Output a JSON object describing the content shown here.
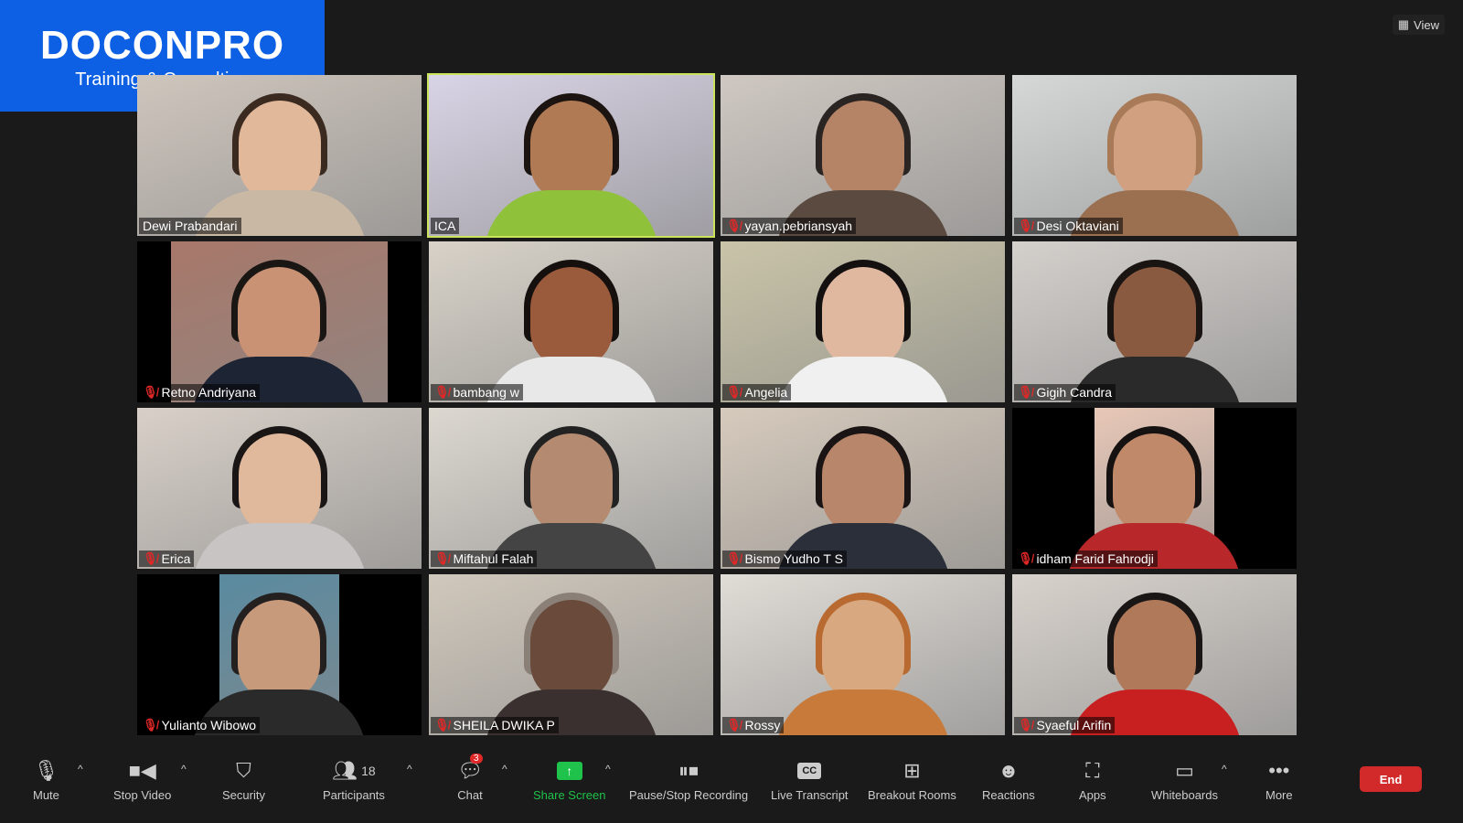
{
  "logo": {
    "title": "DOCONPRO",
    "subtitle": "Training & Consulting"
  },
  "view_button": {
    "label": "View",
    "icon": "grid-icon"
  },
  "participants": [
    {
      "name": "Dewi Prabandari",
      "muted": false,
      "bg": "#cfc6bd",
      "skin": "#e2b89a",
      "hair": "#3a2a20",
      "shirt": "#c9b9a4"
    },
    {
      "name": "ICA",
      "muted": false,
      "active": true,
      "bg": "#d9d4e6",
      "skin": "#b07a55",
      "hair": "#1c1410",
      "shirt": "#8fc23a"
    },
    {
      "name": "yayan.pebriansyah",
      "muted": true,
      "bg": "#cfc8c2",
      "skin": "#b58466",
      "hair": "#2a2422",
      "shirt": "#5a4a40"
    },
    {
      "name": "Desi Oktaviani",
      "muted": true,
      "bg": "#d6d8d8",
      "skin": "#d0a080",
      "hair": "#a87a58",
      "shirt": "#9a7050"
    },
    {
      "name": "Retno Andriyana",
      "muted": true,
      "bg": "#a8786a",
      "skin": "#c99274",
      "hair": "#1a1614",
      "shirt": "#1d2434",
      "pillar": [
        12,
        88
      ]
    },
    {
      "name": "bambang w",
      "muted": true,
      "bg": "#d8d2c8",
      "skin": "#9a5a3c",
      "hair": "#15100e",
      "shirt": "#e8e8e8"
    },
    {
      "name": "Angelia",
      "muted": true,
      "bg": "#c9c4a8",
      "skin": "#e0b8a0",
      "hair": "#141010",
      "shirt": "#f0f0f0"
    },
    {
      "name": "Gigih Candra",
      "muted": true,
      "bg": "#d4d0cc",
      "skin": "#8a5a40",
      "hair": "#1a1412",
      "shirt": "#2a2a2a"
    },
    {
      "name": "Erica",
      "muted": true,
      "bg": "#d8d0c8",
      "skin": "#e0b89c",
      "hair": "#1a1616",
      "shirt": "#c8c4c4"
    },
    {
      "name": "Miftahul Falah",
      "muted": true,
      "bg": "#dcd8d0",
      "skin": "#b48a70",
      "hair": "#222",
      "shirt": "#444"
    },
    {
      "name": "Bismo Yudho T S",
      "muted": true,
      "bg": "#d6cabc",
      "skin": "#b8866a",
      "hair": "#1a1414",
      "shirt": "#2a2f3a"
    },
    {
      "name": "idham Farid Fahrodji",
      "muted": true,
      "bg": "#e8c8b8",
      "skin": "#c08a6a",
      "hair": "#161212",
      "shirt": "#b8282a",
      "pillar": [
        29,
        71
      ]
    },
    {
      "name": "Yulianto Wibowo",
      "muted": true,
      "bg": "#5a8aa0",
      "skin": "#c89a7c",
      "hair": "#242020",
      "shirt": "#2a2a2a",
      "pillar": [
        29,
        71
      ]
    },
    {
      "name": "SHEILA DWIKA P",
      "muted": true,
      "bg": "#d0c8bc",
      "skin": "#6a4a3a",
      "hair": "#8a8078",
      "shirt": "#3a3030"
    },
    {
      "name": "Rossy",
      "muted": true,
      "bg": "#e0dcd6",
      "skin": "#d8a880",
      "hair": "#b86a30",
      "shirt": "#c87a3a"
    },
    {
      "name": "Syaeful Arifin",
      "muted": true,
      "bg": "#d8d2cc",
      "skin": "#b07a5a",
      "hair": "#1a1616",
      "shirt": "#c82020"
    }
  ],
  "toolbar": {
    "mute": {
      "label": "Mute",
      "icon": "microphone-icon"
    },
    "video": {
      "label": "Stop Video",
      "icon": "video-camera-icon"
    },
    "security": {
      "label": "Security",
      "icon": "shield-icon"
    },
    "participants": {
      "label": "Participants",
      "count": "18",
      "icon": "participants-icon"
    },
    "chat": {
      "label": "Chat",
      "badge": "3",
      "icon": "chat-icon"
    },
    "share": {
      "label": "Share Screen",
      "icon": "share-arrow-icon",
      "color": "#1fc24a"
    },
    "recording": {
      "label": "Pause/Stop Recording",
      "icon": "pause-stop-icon"
    },
    "transcript": {
      "label": "Live Transcript",
      "icon": "cc-icon",
      "glyph": "CC"
    },
    "breakout": {
      "label": "Breakout Rooms",
      "icon": "breakout-grid-icon"
    },
    "reactions": {
      "label": "Reactions",
      "icon": "smiley-plus-icon"
    },
    "apps": {
      "label": "Apps",
      "icon": "apps-icon"
    },
    "whiteboards": {
      "label": "Whiteboards",
      "icon": "whiteboard-icon"
    },
    "more": {
      "label": "More",
      "icon": "ellipsis-icon"
    },
    "end": {
      "label": "End",
      "color": "#d22a2a"
    }
  }
}
